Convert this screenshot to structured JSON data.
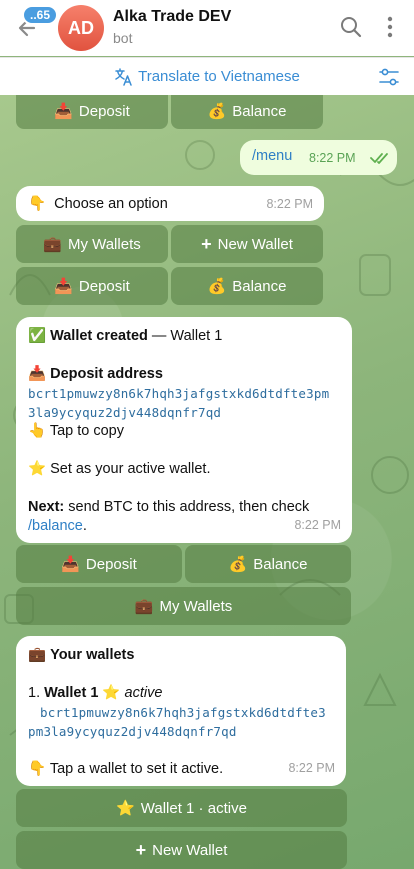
{
  "header": {
    "unread_count": "..65",
    "avatar_initials": "AD",
    "title": "Alka Trade DEV",
    "subtitle": "bot",
    "avatar_color": "#e85a45"
  },
  "translate_bar": {
    "label": "Translate to Vietnamese"
  },
  "keyboards": {
    "top": {
      "deposit": "Deposit",
      "balance": "Balance"
    },
    "after_menu": {
      "my_wallets": "My Wallets",
      "new_wallet": "New Wallet",
      "deposit": "Deposit",
      "balance": "Balance"
    },
    "after_created": {
      "deposit": "Deposit",
      "balance": "Balance",
      "my_wallets": "My Wallets"
    },
    "after_list": {
      "wallet_active": "Wallet 1 · active",
      "new_wallet": "New Wallet"
    }
  },
  "messages": {
    "menu_cmd": {
      "text": "/menu",
      "time": "8:22 PM"
    },
    "choose": {
      "text": "Choose an option",
      "time": "8:22 PM"
    },
    "created": {
      "title_bold": "Wallet created",
      "title_rest": " — Wallet 1",
      "deposit_label": "Deposit address",
      "address_line1": "bcrt1pmuwzy8n6k7hqh3jafgstxkd6dtdfte3pm",
      "address_line2": "3la9ycyquz2djv448dqnfr7qd",
      "tap_copy": "Tap to copy",
      "active_note": "Set as your active wallet.",
      "next_bold": "Next:",
      "next_rest": " send BTC to this address, then check",
      "balance_cmd": "/balance",
      "balance_suffix": ".",
      "time": "8:22 PM"
    },
    "wallets": {
      "title": "Your wallets",
      "item_index": "1.",
      "item_name": "Wallet 1",
      "item_status": "active",
      "address_line1": "bcrt1pmuwzy8n6k7hqh3jafgstxkd6dtdfte3",
      "address_line2": "pm3la9ycyquz2djv448dqnfr7qd",
      "hint": "Tap a wallet to set it active.",
      "time": "8:22 PM"
    }
  },
  "colors": {
    "accent": "#3a8dd4",
    "outgoing_bubble": "#effdde",
    "read_check": "#5fb04f"
  }
}
